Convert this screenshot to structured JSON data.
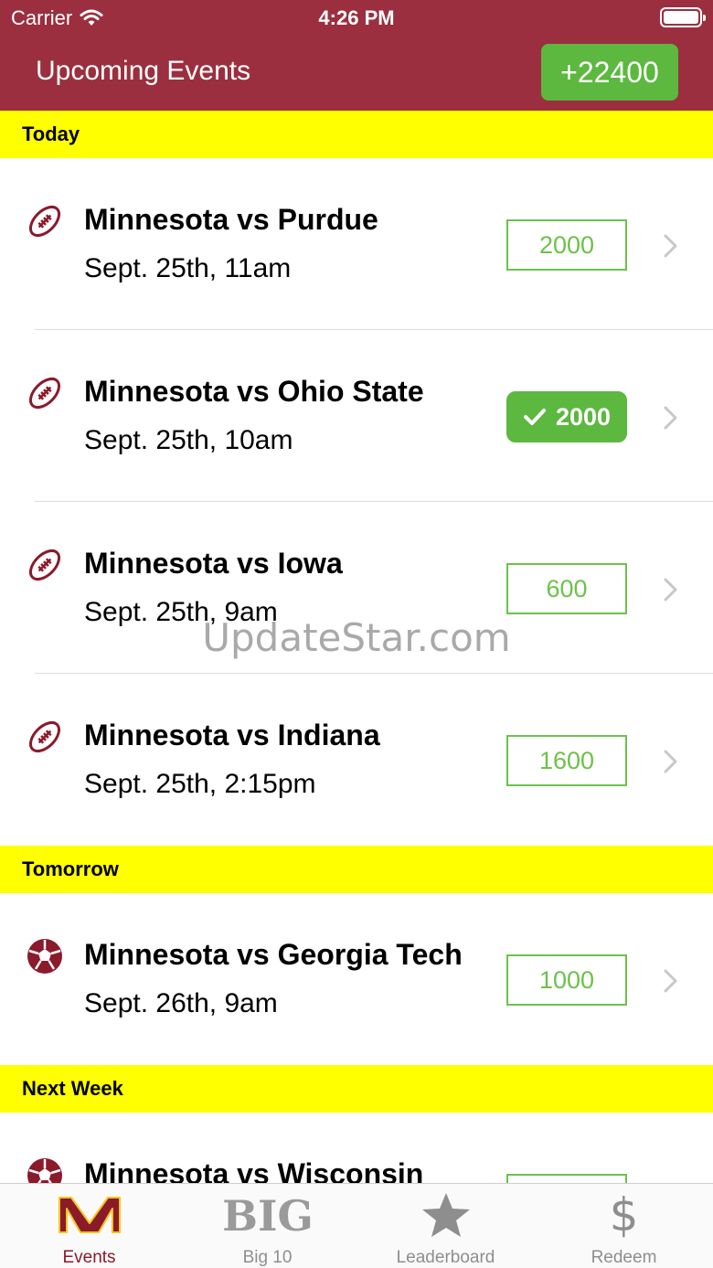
{
  "status_bar": {
    "carrier": "Carrier",
    "time": "4:26 PM"
  },
  "header": {
    "title": "Upcoming Events",
    "points": "+22400"
  },
  "sections": [
    {
      "title": "Today",
      "events": [
        {
          "title": "Minnesota vs Purdue",
          "time": "Sept. 25th, 11am",
          "points": "2000",
          "sport": "football-icon",
          "selected": false
        },
        {
          "title": "Minnesota vs Ohio State",
          "time": "Sept. 25th, 10am",
          "points": "2000",
          "sport": "football-icon",
          "selected": true
        },
        {
          "title": "Minnesota vs Iowa",
          "time": "Sept. 25th, 9am",
          "points": "600",
          "sport": "football-icon",
          "selected": false
        },
        {
          "title": "Minnesota vs Indiana",
          "time": "Sept. 25th, 2:15pm",
          "points": "1600",
          "sport": "football-icon",
          "selected": false
        }
      ]
    },
    {
      "title": "Tomorrow",
      "events": [
        {
          "title": "Minnesota vs Georgia Tech",
          "time": "Sept. 26th, 9am",
          "points": "1000",
          "sport": "soccer-ball-icon",
          "selected": false
        }
      ]
    },
    {
      "title": "Next Week",
      "events": [
        {
          "title": "Minnesota vs Wisconsin",
          "time": "",
          "points": "",
          "sport": "soccer-ball-icon",
          "selected": false
        }
      ]
    }
  ],
  "watermark": "UpdateStar.com",
  "tabs": [
    {
      "label": "Events",
      "icon": "minnesota-m-logo-icon",
      "active": true
    },
    {
      "label": "Big 10",
      "icon": "big-ten-logo-icon",
      "active": false
    },
    {
      "label": "Leaderboard",
      "icon": "star-icon",
      "active": false
    },
    {
      "label": "Redeem",
      "icon": "dollar-icon",
      "active": false
    }
  ],
  "colors": {
    "header": "#9b2f3f",
    "section": "#ffff00",
    "accent_green": "#5cb83f",
    "maroon": "#8b1a2b"
  }
}
